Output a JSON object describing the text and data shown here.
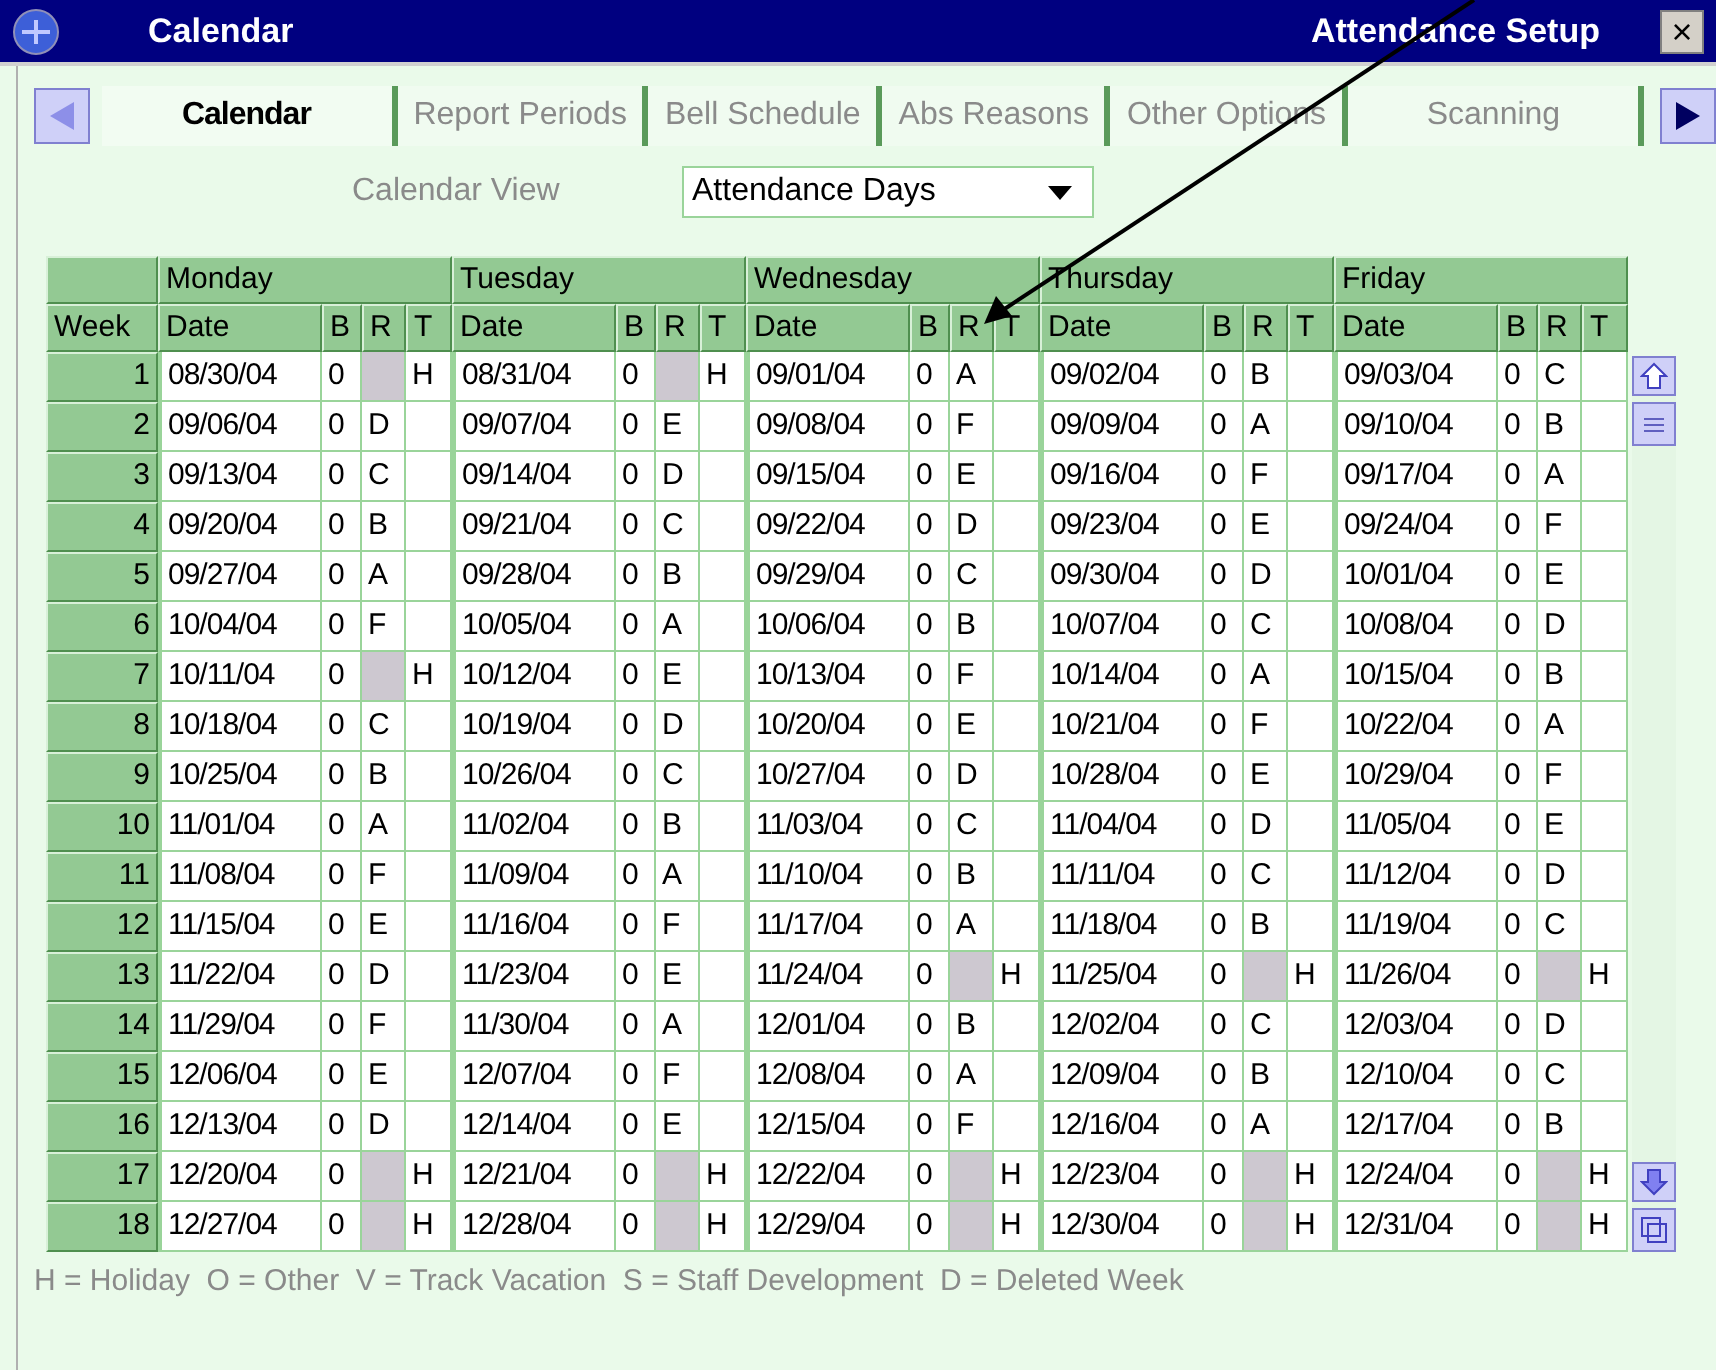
{
  "window": {
    "title": "Calendar",
    "subtitle": "Attendance Setup",
    "close": "×"
  },
  "tabs": [
    {
      "label": "Calendar",
      "selected": true
    },
    {
      "label": "Report Periods",
      "selected": false
    },
    {
      "label": "Bell Schedule",
      "selected": false
    },
    {
      "label": "Abs Reasons",
      "selected": false
    },
    {
      "label": "Other Options",
      "selected": false
    },
    {
      "label": "Scanning",
      "selected": false
    }
  ],
  "calendar_view": {
    "label": "Calendar View",
    "value": "Attendance Days"
  },
  "table": {
    "week_header": "Week",
    "days": [
      {
        "name": "Monday",
        "columns": [
          "Date",
          "B",
          "R",
          "T"
        ]
      },
      {
        "name": "Tuesday",
        "columns": [
          "Date",
          "B",
          "R",
          "T"
        ]
      },
      {
        "name": "Wednesday",
        "columns": [
          "Date",
          "B",
          "R",
          "T"
        ]
      },
      {
        "name": "Thursday",
        "columns": [
          "Date",
          "B",
          "R",
          "T"
        ]
      },
      {
        "name": "Friday",
        "columns": [
          "Date",
          "B",
          "R",
          "T"
        ]
      }
    ],
    "rows": [
      {
        "week": "1",
        "days": [
          {
            "date": "08/30/04",
            "b": "0",
            "t": "H"
          },
          {
            "date": "08/31/04",
            "b": "0",
            "t": "H"
          },
          {
            "date": "09/01/04",
            "b": "0",
            "r": "A"
          },
          {
            "date": "09/02/04",
            "b": "0",
            "r": "B"
          },
          {
            "date": "09/03/04",
            "b": "0",
            "r": "C"
          }
        ]
      },
      {
        "week": "2",
        "days": [
          {
            "date": "09/06/04",
            "b": "0",
            "r": "D"
          },
          {
            "date": "09/07/04",
            "b": "0",
            "r": "E"
          },
          {
            "date": "09/08/04",
            "b": "0",
            "r": "F"
          },
          {
            "date": "09/09/04",
            "b": "0",
            "r": "A"
          },
          {
            "date": "09/10/04",
            "b": "0",
            "r": "B"
          }
        ]
      },
      {
        "week": "3",
        "days": [
          {
            "date": "09/13/04",
            "b": "0",
            "r": "C"
          },
          {
            "date": "09/14/04",
            "b": "0",
            "r": "D"
          },
          {
            "date": "09/15/04",
            "b": "0",
            "r": "E"
          },
          {
            "date": "09/16/04",
            "b": "0",
            "r": "F"
          },
          {
            "date": "09/17/04",
            "b": "0",
            "r": "A"
          }
        ]
      },
      {
        "week": "4",
        "days": [
          {
            "date": "09/20/04",
            "b": "0",
            "r": "B"
          },
          {
            "date": "09/21/04",
            "b": "0",
            "r": "C"
          },
          {
            "date": "09/22/04",
            "b": "0",
            "r": "D"
          },
          {
            "date": "09/23/04",
            "b": "0",
            "r": "E"
          },
          {
            "date": "09/24/04",
            "b": "0",
            "r": "F"
          }
        ]
      },
      {
        "week": "5",
        "days": [
          {
            "date": "09/27/04",
            "b": "0",
            "r": "A"
          },
          {
            "date": "09/28/04",
            "b": "0",
            "r": "B"
          },
          {
            "date": "09/29/04",
            "b": "0",
            "r": "C"
          },
          {
            "date": "09/30/04",
            "b": "0",
            "r": "D"
          },
          {
            "date": "10/01/04",
            "b": "0",
            "r": "E"
          }
        ]
      },
      {
        "week": "6",
        "days": [
          {
            "date": "10/04/04",
            "b": "0",
            "r": "F"
          },
          {
            "date": "10/05/04",
            "b": "0",
            "r": "A"
          },
          {
            "date": "10/06/04",
            "b": "0",
            "r": "B"
          },
          {
            "date": "10/07/04",
            "b": "0",
            "r": "C"
          },
          {
            "date": "10/08/04",
            "b": "0",
            "r": "D"
          }
        ]
      },
      {
        "week": "7",
        "days": [
          {
            "date": "10/11/04",
            "b": "0",
            "t": "H"
          },
          {
            "date": "10/12/04",
            "b": "0",
            "r": "E"
          },
          {
            "date": "10/13/04",
            "b": "0",
            "r": "F"
          },
          {
            "date": "10/14/04",
            "b": "0",
            "r": "A"
          },
          {
            "date": "10/15/04",
            "b": "0",
            "r": "B"
          }
        ]
      },
      {
        "week": "8",
        "days": [
          {
            "date": "10/18/04",
            "b": "0",
            "r": "C"
          },
          {
            "date": "10/19/04",
            "b": "0",
            "r": "D"
          },
          {
            "date": "10/20/04",
            "b": "0",
            "r": "E"
          },
          {
            "date": "10/21/04",
            "b": "0",
            "r": "F"
          },
          {
            "date": "10/22/04",
            "b": "0",
            "r": "A"
          }
        ]
      },
      {
        "week": "9",
        "days": [
          {
            "date": "10/25/04",
            "b": "0",
            "r": "B"
          },
          {
            "date": "10/26/04",
            "b": "0",
            "r": "C"
          },
          {
            "date": "10/27/04",
            "b": "0",
            "r": "D"
          },
          {
            "date": "10/28/04",
            "b": "0",
            "r": "E"
          },
          {
            "date": "10/29/04",
            "b": "0",
            "r": "F"
          }
        ]
      },
      {
        "week": "10",
        "days": [
          {
            "date": "11/01/04",
            "b": "0",
            "r": "A"
          },
          {
            "date": "11/02/04",
            "b": "0",
            "r": "B"
          },
          {
            "date": "11/03/04",
            "b": "0",
            "r": "C"
          },
          {
            "date": "11/04/04",
            "b": "0",
            "r": "D"
          },
          {
            "date": "11/05/04",
            "b": "0",
            "r": "E"
          }
        ]
      },
      {
        "week": "11",
        "days": [
          {
            "date": "11/08/04",
            "b": "0",
            "r": "F"
          },
          {
            "date": "11/09/04",
            "b": "0",
            "r": "A"
          },
          {
            "date": "11/10/04",
            "b": "0",
            "r": "B"
          },
          {
            "date": "11/11/04",
            "b": "0",
            "r": "C"
          },
          {
            "date": "11/12/04",
            "b": "0",
            "r": "D"
          }
        ]
      },
      {
        "week": "12",
        "days": [
          {
            "date": "11/15/04",
            "b": "0",
            "r": "E"
          },
          {
            "date": "11/16/04",
            "b": "0",
            "r": "F"
          },
          {
            "date": "11/17/04",
            "b": "0",
            "r": "A"
          },
          {
            "date": "11/18/04",
            "b": "0",
            "r": "B"
          },
          {
            "date": "11/19/04",
            "b": "0",
            "r": "C"
          }
        ]
      },
      {
        "week": "13",
        "days": [
          {
            "date": "11/22/04",
            "b": "0",
            "r": "D"
          },
          {
            "date": "11/23/04",
            "b": "0",
            "r": "E"
          },
          {
            "date": "11/24/04",
            "b": "0",
            "t": "H"
          },
          {
            "date": "11/25/04",
            "b": "0",
            "t": "H"
          },
          {
            "date": "11/26/04",
            "b": "0",
            "t": "H"
          }
        ]
      },
      {
        "week": "14",
        "days": [
          {
            "date": "11/29/04",
            "b": "0",
            "r": "F"
          },
          {
            "date": "11/30/04",
            "b": "0",
            "r": "A"
          },
          {
            "date": "12/01/04",
            "b": "0",
            "r": "B"
          },
          {
            "date": "12/02/04",
            "b": "0",
            "r": "C"
          },
          {
            "date": "12/03/04",
            "b": "0",
            "r": "D"
          }
        ]
      },
      {
        "week": "15",
        "days": [
          {
            "date": "12/06/04",
            "b": "0",
            "r": "E"
          },
          {
            "date": "12/07/04",
            "b": "0",
            "r": "F"
          },
          {
            "date": "12/08/04",
            "b": "0",
            "r": "A"
          },
          {
            "date": "12/09/04",
            "b": "0",
            "r": "B"
          },
          {
            "date": "12/10/04",
            "b": "0",
            "r": "C"
          }
        ]
      },
      {
        "week": "16",
        "days": [
          {
            "date": "12/13/04",
            "b": "0",
            "r": "D"
          },
          {
            "date": "12/14/04",
            "b": "0",
            "r": "E"
          },
          {
            "date": "12/15/04",
            "b": "0",
            "r": "F"
          },
          {
            "date": "12/16/04",
            "b": "0",
            "r": "A"
          },
          {
            "date": "12/17/04",
            "b": "0",
            "r": "B"
          }
        ]
      },
      {
        "week": "17",
        "days": [
          {
            "date": "12/20/04",
            "b": "0",
            "t": "H"
          },
          {
            "date": "12/21/04",
            "b": "0",
            "t": "H"
          },
          {
            "date": "12/22/04",
            "b": "0",
            "t": "H"
          },
          {
            "date": "12/23/04",
            "b": "0",
            "t": "H"
          },
          {
            "date": "12/24/04",
            "b": "0",
            "t": "H"
          }
        ]
      },
      {
        "week": "18",
        "days": [
          {
            "date": "12/27/04",
            "b": "0",
            "t": "H"
          },
          {
            "date": "12/28/04",
            "b": "0",
            "t": "H"
          },
          {
            "date": "12/29/04",
            "b": "0",
            "t": "H"
          },
          {
            "date": "12/30/04",
            "b": "0",
            "t": "H"
          },
          {
            "date": "12/31/04",
            "b": "0",
            "t": "H"
          }
        ]
      }
    ]
  },
  "legend": "H = Holiday  O = Other  V = Track Vacation  S = Staff Development  D = Deleted Week"
}
